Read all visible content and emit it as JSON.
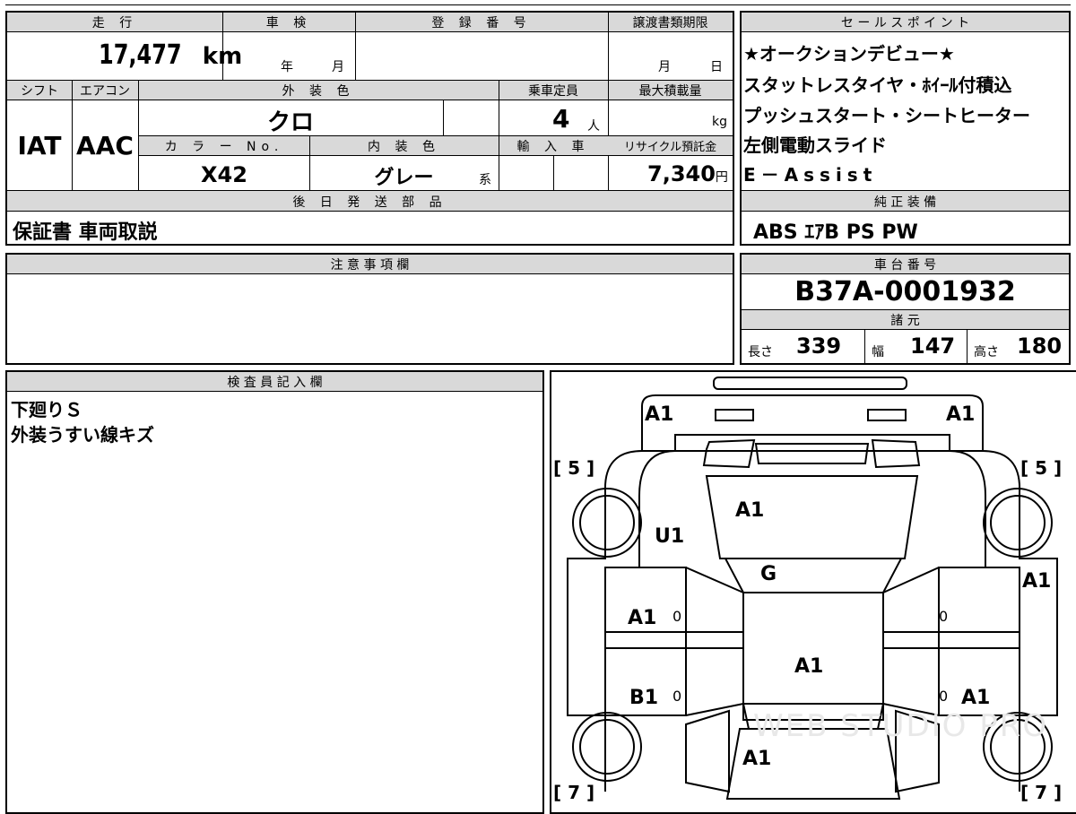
{
  "top_section": {
    "mileage": {
      "label": "走 行",
      "value": "17,477",
      "unit": "km"
    },
    "inspection": {
      "label": "車 検",
      "year_label": "年",
      "month_label": "月"
    },
    "registration": {
      "label": "登 録 番 号",
      "value": ""
    },
    "transfer_deadline": {
      "label": "譲渡書類期限",
      "month_label": "月",
      "day_label": "日"
    },
    "shift": {
      "label": "シフト",
      "value": "IAT"
    },
    "aircon": {
      "label": "エアコン",
      "value": "AAC"
    },
    "exterior_color": {
      "label": "外 装 色",
      "value": "クロ"
    },
    "capacity": {
      "label": "乗車定員",
      "value": "4",
      "unit": "人"
    },
    "max_load": {
      "label": "最大積載量",
      "value": "",
      "unit": "kg"
    },
    "color_no": {
      "label": "カ ラ ー No.",
      "value": "X42"
    },
    "interior_color": {
      "label": "内 装 色",
      "value": "グレー",
      "suffix": "系"
    },
    "import": {
      "label": "輸 入 車"
    },
    "recycle_fee": {
      "label": "リサイクル預託金",
      "value": "7,340",
      "unit": "円"
    },
    "later_parts": {
      "label": "後 日 発 送 部 品",
      "value": "保証書 車両取説"
    }
  },
  "sales_points": {
    "label": "セ ー ル ス ポ イ ン ト",
    "lines": [
      "★オークションデビュー★",
      "スタットレスタイヤ・ﾎｲｰﾙ付積込",
      "プッシュスタート・シートヒーター",
      "左側電動スライド",
      "E－Assist"
    ]
  },
  "genuine_equipment": {
    "label": "純 正 装 備",
    "value": "ABS ｴｱB PS PW"
  },
  "notes": {
    "label": "注 意 事 項 欄",
    "value": ""
  },
  "chassis": {
    "label": "車 台 番 号",
    "value": "B37A-0001932"
  },
  "specs": {
    "label": "諸 元",
    "length": {
      "label": "長さ",
      "value": "339"
    },
    "width": {
      "label": "幅",
      "value": "147"
    },
    "height": {
      "label": "高さ",
      "value": "180"
    }
  },
  "inspector": {
    "label": "検 査 員 記 入 欄",
    "lines": [
      "下廻りＳ",
      "外装うすい線キズ"
    ]
  },
  "diagram": {
    "tire_front_left": "[ 5 ]",
    "tire_front_right": "[ 5 ]",
    "tire_rear_left": "[ 7 ]",
    "tire_rear_right": "[ 7 ]",
    "marks": {
      "front_left_corner": "A1",
      "front_right_corner": "A1",
      "hood": "A1",
      "front_left_fender": "U1",
      "windshield": "G",
      "right_side_upper": "A1",
      "left_front_door": "A1",
      "roof": "A1",
      "left_rear_door": "B1",
      "right_rear": "A1",
      "rear_gate": "A1"
    },
    "zero_marks": [
      "0",
      "0",
      "0",
      "0"
    ],
    "watermark": "WEB STUDIO PRO"
  }
}
